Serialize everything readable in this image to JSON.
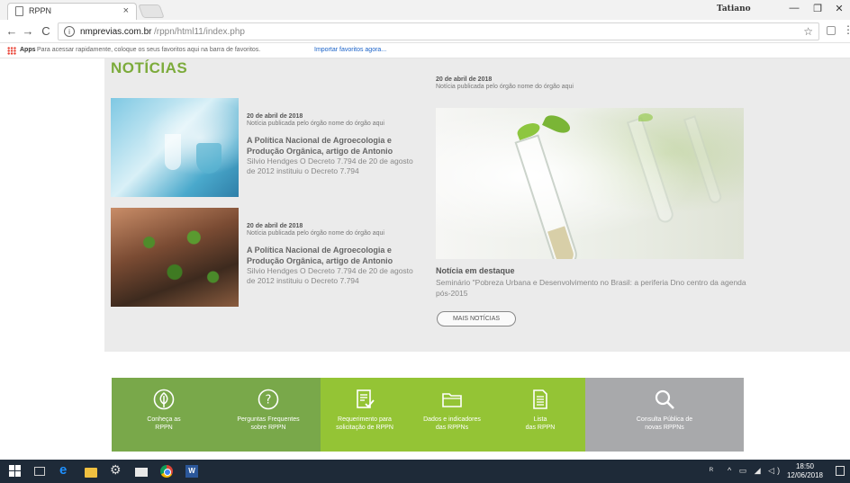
{
  "browser": {
    "tab_title": "RPPN",
    "tab_close": "×",
    "profile_name": "Tatiano",
    "window_controls": {
      "minimize": "—",
      "maximize": "❐",
      "close": "✕"
    },
    "nav": {
      "back": "←",
      "forward": "→",
      "reload": "C"
    },
    "url_host": "nmprevias.com.br",
    "url_path": "/rppn/html11/index.php",
    "bookmarks": {
      "apps_label": "Apps",
      "hint_text": "Para acessar rapidamente, coloque os seus favoritos aqui na barra de favoritos.",
      "import_link": "Importar favoritos agora..."
    }
  },
  "page": {
    "section_title": "NOTÍCIAS",
    "news": [
      {
        "date": "20 de abril de 2018",
        "source": "Notícia publicada pelo órgão nome do órgão aqui",
        "headline": "A Política Nacional de Agroecologia e Produção Orgânica, artigo de Antonio",
        "excerpt": "Silvio Hendges O Decreto 7.794 de 20 de agosto de 2012 instituiu o Decreto 7.794",
        "image": "lab-scientist-image"
      },
      {
        "date": "20 de abril de 2018",
        "source": "Notícia publicada pelo órgão nome do órgão aqui",
        "headline": "A Política Nacional de Agroecologia e Produção Orgânica, artigo de Antonio",
        "excerpt": "Silvio Hendges O Decreto 7.794 de 20 de agosto de 2012 instituiu o Decreto 7.794",
        "image": "hands-seedlings-image"
      }
    ],
    "featured": {
      "date": "20 de abril de 2018",
      "source": "Notícia publicada pelo órgão nome do órgão aqui",
      "label": "Notícia em destaque",
      "text": "Seminário \"Pobreza Urbana e Desenvolvimento no Brasil: a periferia Dno centro da agenda pós-2015",
      "button": "MAIS NOTÍCIAS",
      "image": "test-tube-sprouts-image"
    },
    "services": [
      {
        "line1": "Conheça as",
        "line2": "RPPN",
        "icon": "leaf-icon",
        "color": "#79a84a"
      },
      {
        "line1": "Perguntas Frequentes",
        "line2": "sobre RPPN",
        "icon": "question-icon",
        "color": "#79a84a"
      },
      {
        "line1": "Requerimento para",
        "line2": "solicitação de RPPN",
        "icon": "document-check-icon",
        "color": "#94c435"
      },
      {
        "line1": "Dados e indicadores",
        "line2": "das RPPNs",
        "icon": "folder-icon",
        "color": "#94c435"
      },
      {
        "line1": "Lista",
        "line2": "das RPPN",
        "icon": "list-document-icon",
        "color": "#94c435"
      },
      {
        "line1": "Consulta Pública de",
        "line2": "novas RPPNs",
        "icon": "search-icon",
        "color": "#a8a9ab"
      }
    ],
    "colors": {
      "brand_green": "#7cab3b",
      "news_background": "#ebebeb"
    }
  },
  "taskbar": {
    "time": "18:50",
    "date": "12/06/2018",
    "word_label": "W"
  }
}
